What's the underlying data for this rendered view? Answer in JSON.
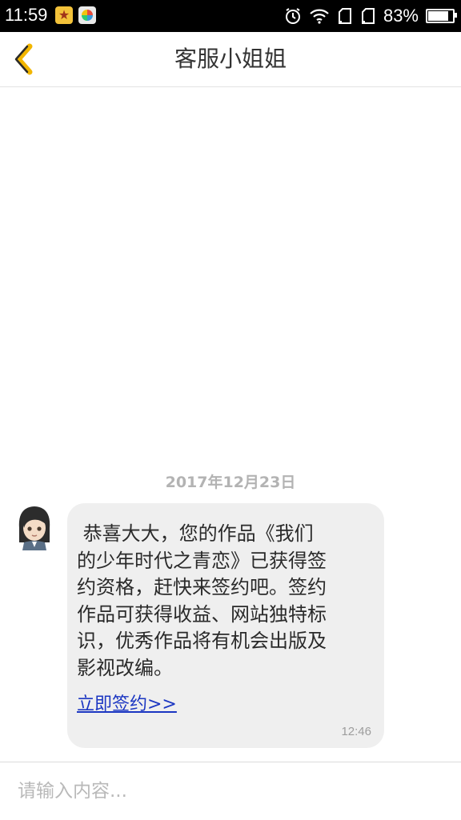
{
  "status_bar": {
    "time": "11:59",
    "battery": "83%",
    "battery_level": 0.83
  },
  "header": {
    "title": "客服小姐姐",
    "back_icon": "chevron-left-icon",
    "accent_color": "#f2b600"
  },
  "chat": {
    "date": "2017年12月23日",
    "messages": [
      {
        "sender": "avatar",
        "text": " 恭喜大大，您的作品《我们\n的少年时代之青恋》已获得签\n约资格，赶快来签约吧。签约\n作品可获得收益、网站独特标\n识，优秀作品将有机会出版及\n影视改编。",
        "link": "立即签约>>",
        "time": "12:46"
      }
    ]
  },
  "input": {
    "placeholder": "请输入内容..."
  }
}
